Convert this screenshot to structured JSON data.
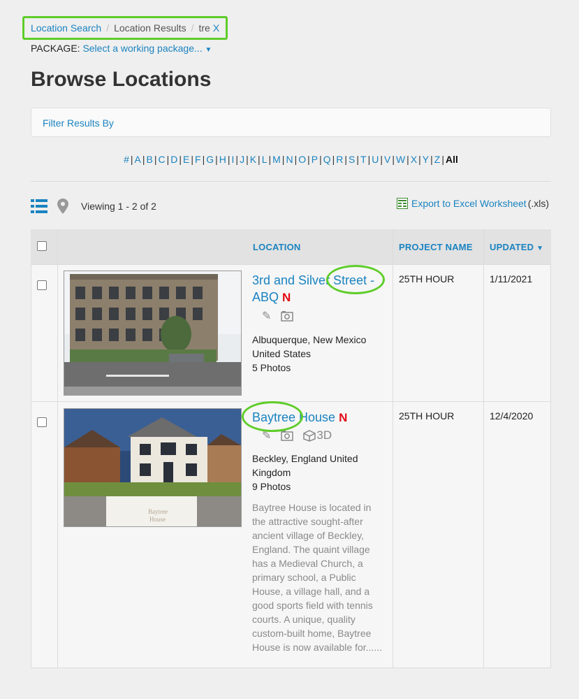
{
  "breadcrumb": {
    "location_search": "Location Search",
    "sep1": "/",
    "location_results": "Location Results",
    "sep2": "/",
    "query": "tre",
    "clear": "X"
  },
  "package": {
    "label": "PACKAGE:",
    "select": "Select a working package...",
    "caret": "▼"
  },
  "page_title": "Browse Locations",
  "filter": {
    "label": "Filter Results By"
  },
  "alphabet": [
    "#",
    "A",
    "B",
    "C",
    "D",
    "E",
    "F",
    "G",
    "H",
    "I",
    "J",
    "K",
    "L",
    "M",
    "N",
    "O",
    "P",
    "Q",
    "R",
    "S",
    "T",
    "U",
    "V",
    "W",
    "X",
    "Y",
    "Z"
  ],
  "alphabet_all": "All",
  "viewing": "Viewing 1 - 2 of 2",
  "export": {
    "label": "Export to Excel Worksheet",
    "suffix": "(.xls)"
  },
  "table": {
    "headers": {
      "location": "LOCATION",
      "project": "PROJECT NAME",
      "updated": "UPDATED",
      "updated_caret": "▼"
    },
    "rows": [
      {
        "title_line1": "3rd and Silver Street -",
        "title_line2": "ABQ",
        "netflix": "N",
        "address_line1": "Albuquerque, New Mexico",
        "address_line2": "United States",
        "photos": "5 Photos",
        "project": "25TH HOUR",
        "updated": "1/11/2021"
      },
      {
        "title_line1": "Baytree House",
        "netflix": "N",
        "badge_3d": "3D",
        "address_line1": "Beckley, England United",
        "address_line2": "Kingdom",
        "photos": "9 Photos",
        "description": "Baytree House is located in the attractive sought-after ancient village of Beckley, England. The quaint village has a Medieval Church, a primary school, a Public House, a village hall, and a good sports field with tennis courts. A unique, quality custom-built home, Baytree House is now available for......",
        "project": "25TH HOUR",
        "updated": "12/4/2020"
      }
    ]
  },
  "colors": {
    "link": "#1a83c0",
    "highlight": "#5fcd2a",
    "netflix": "#e50914"
  }
}
